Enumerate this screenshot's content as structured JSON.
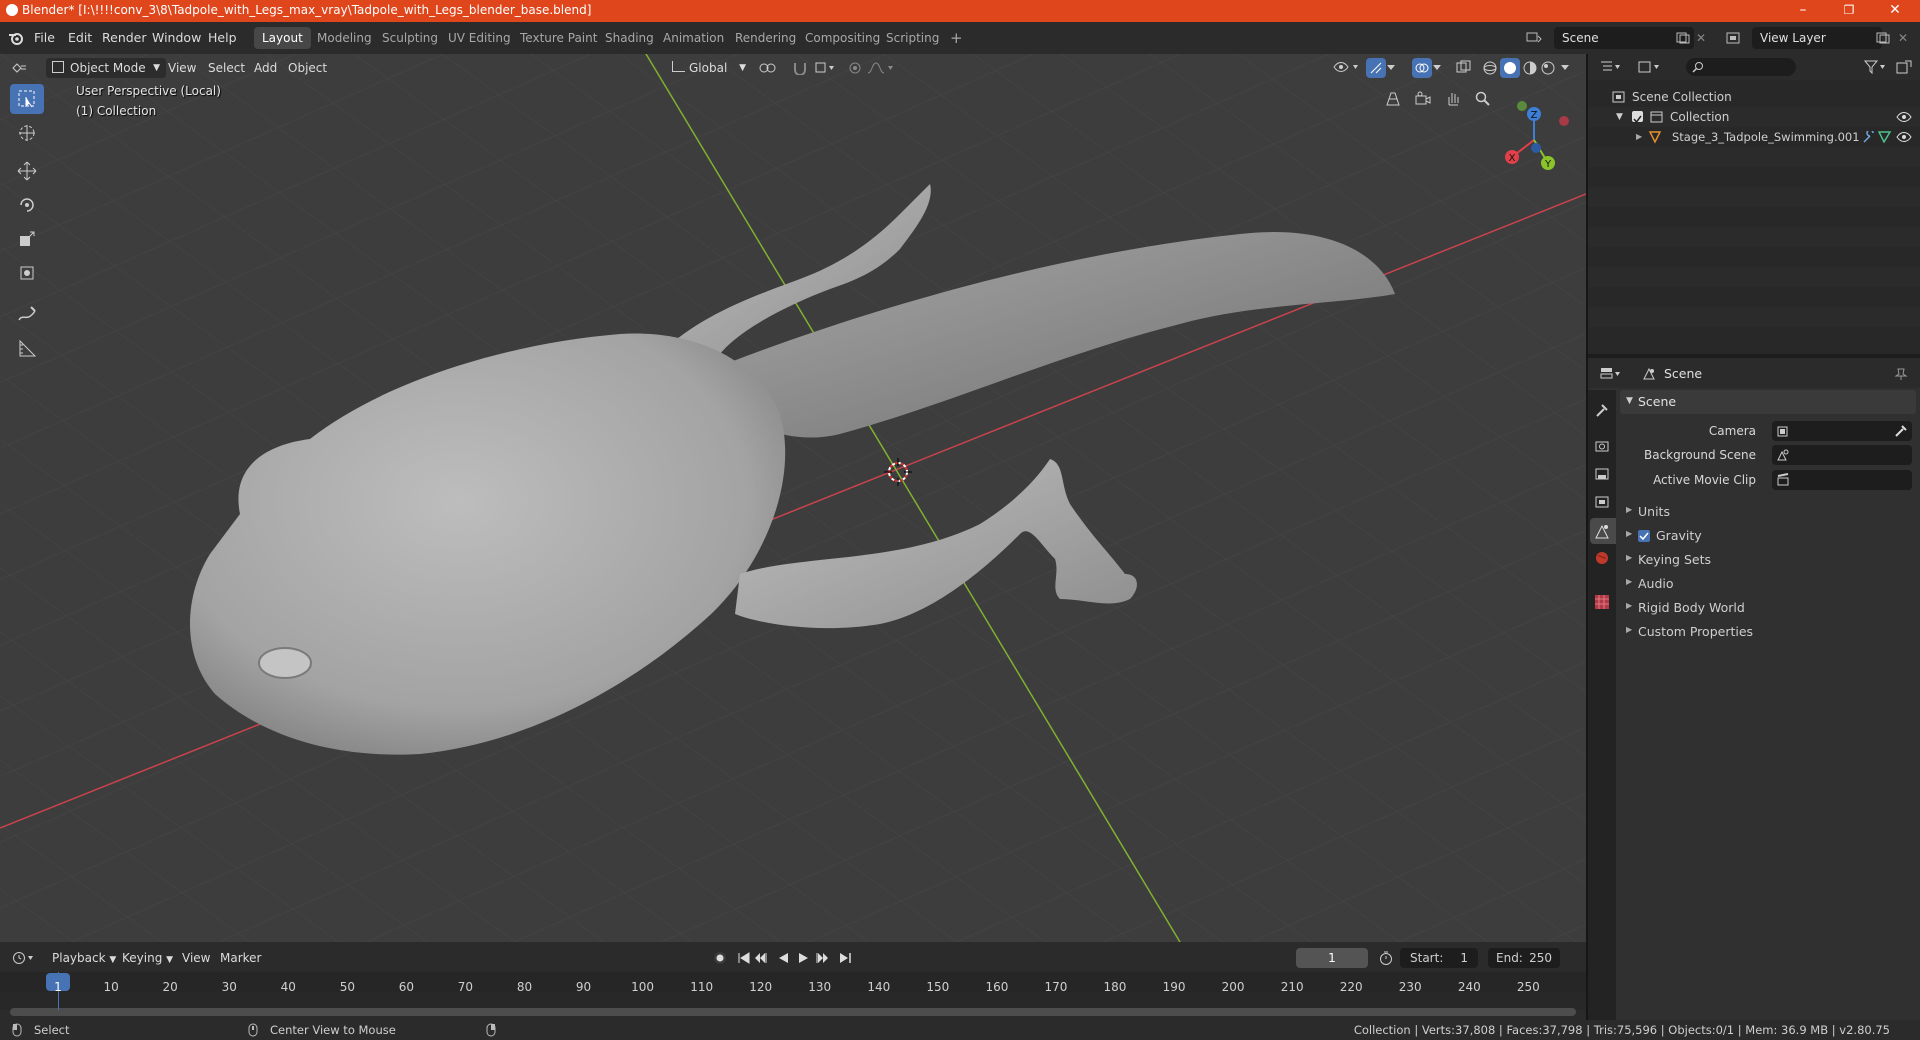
{
  "window": {
    "title": "Blender* [I:\\!!!!conv_3\\8\\Tadpole_with_Legs_max_vray\\Tadpole_with_Legs_blender_base.blend]",
    "minimize": "–",
    "maximize": "❐",
    "close": "✕"
  },
  "menu": [
    "File",
    "Edit",
    "Render",
    "Window",
    "Help"
  ],
  "workspaces": [
    "Layout",
    "Modeling",
    "Sculpting",
    "UV Editing",
    "Texture Paint",
    "Shading",
    "Animation",
    "Rendering",
    "Compositing",
    "Scripting"
  ],
  "active_workspace": "Layout",
  "add_workspace": "+",
  "scene_name": "Scene",
  "view_layer": "View Layer",
  "viewport": {
    "mode": "Object Mode",
    "menus": [
      "View",
      "Select",
      "Add",
      "Object"
    ],
    "orientation": "Global",
    "perspective_label": "User Perspective (Local)",
    "collection_label": "(1) Collection",
    "axes": {
      "x": "X",
      "y": "Y",
      "z": "Z"
    }
  },
  "outliner": {
    "root": "Scene Collection",
    "collection": "Collection",
    "object": "Stage_3_Tadpole_Swimming.001"
  },
  "properties": {
    "header": "Scene",
    "section": "Scene",
    "camera_label": "Camera",
    "background_scene_label": "Background Scene",
    "active_movie_clip_label": "Active Movie Clip",
    "panels": [
      "Units",
      "Gravity",
      "Keying Sets",
      "Audio",
      "Rigid Body World",
      "Custom Properties"
    ]
  },
  "timeline": {
    "menus": [
      "Playback",
      "Keying",
      "View",
      "Marker"
    ],
    "current_frame": "1",
    "start_label": "Start:",
    "start": "1",
    "end_label": "End:",
    "end": "250",
    "ticks": [
      "1",
      "10",
      "20",
      "30",
      "40",
      "50",
      "60",
      "70",
      "80",
      "90",
      "100",
      "110",
      "120",
      "130",
      "140",
      "150",
      "160",
      "170",
      "180",
      "190",
      "200",
      "210",
      "220",
      "230",
      "240",
      "250"
    ]
  },
  "status": {
    "left_action": "Select",
    "mid_action": "Center View to Mouse",
    "stats": "Collection | Verts:37,808 | Faces:37,798 | Tris:75,596 | Objects:0/1 | Mem: 36.9 MB | v2.80.75"
  },
  "colors": {
    "title_bar": "#e0461c",
    "accent_blue": "#4772b3",
    "x_axis": "#e0404a",
    "y_axis": "#8ac42a",
    "z_axis": "#3d7fd6"
  }
}
